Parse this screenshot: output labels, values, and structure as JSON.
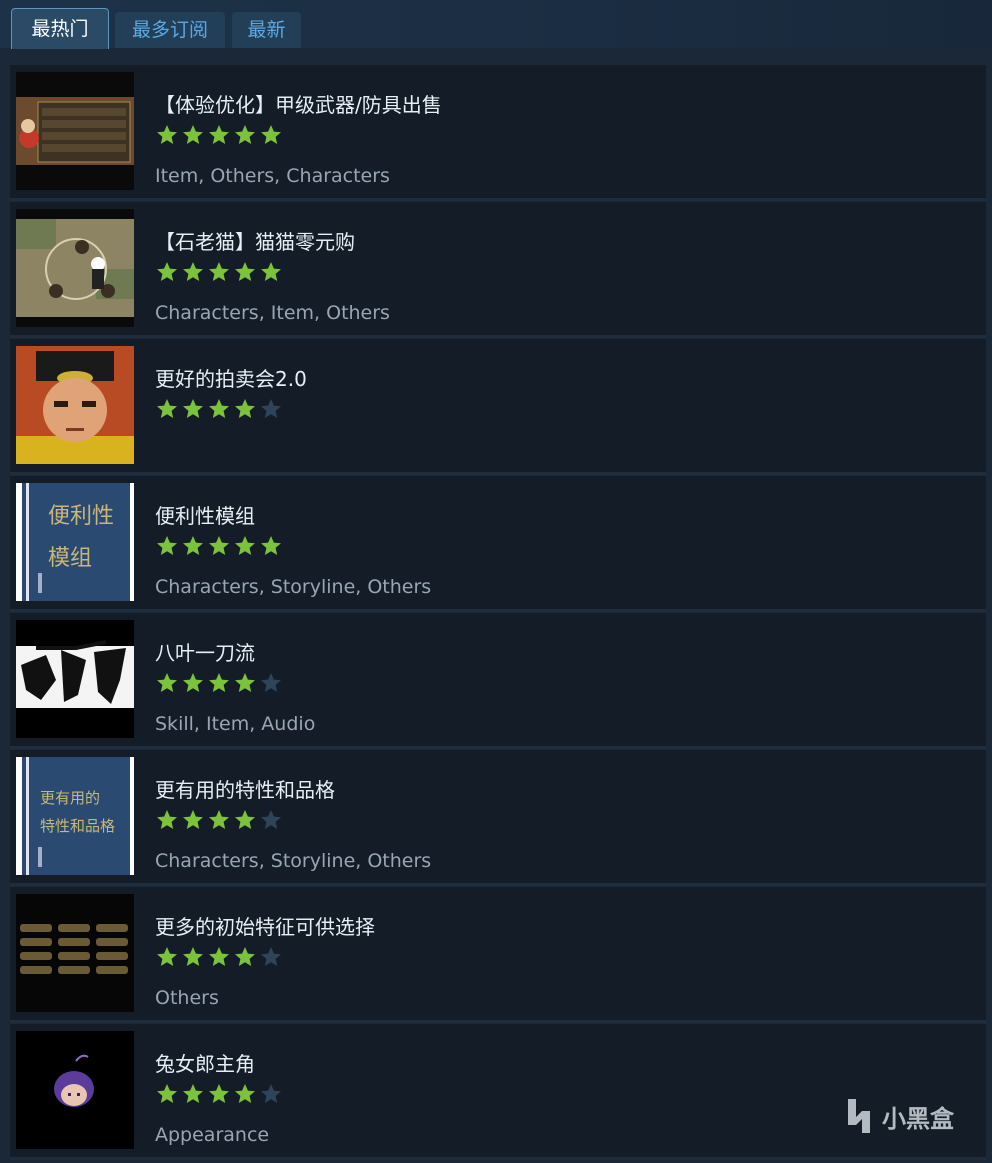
{
  "tabs": [
    {
      "label": "最热门",
      "active": true
    },
    {
      "label": "最多订阅",
      "active": false
    },
    {
      "label": "最新",
      "active": false
    }
  ],
  "items": [
    {
      "title": "【体验优化】甲级武器/防具出售",
      "rating": 5,
      "tags": "Item, Others, Characters"
    },
    {
      "title": "【石老猫】猫猫零元购",
      "rating": 5,
      "tags": "Characters, Item, Others"
    },
    {
      "title": "更好的拍卖会2.0",
      "rating": 4,
      "tags": ""
    },
    {
      "title": "便利性模组",
      "rating": 5,
      "tags": "Characters, Storyline, Others",
      "thumb_text": [
        "便利性",
        "模组"
      ]
    },
    {
      "title": "八叶一刀流",
      "rating": 4,
      "tags": "Skill, Item, Audio"
    },
    {
      "title": "更有用的特性和品格",
      "rating": 4,
      "tags": "Characters, Storyline, Others",
      "thumb_text": [
        "更有用的",
        "特性和品格"
      ]
    },
    {
      "title": "更多的初始特征可供选择",
      "rating": 4,
      "tags": "Others"
    },
    {
      "title": "兔女郎主角",
      "rating": 4,
      "tags": "Appearance"
    }
  ],
  "colors": {
    "star_on": "#7cc23a",
    "star_off": "#2f4458",
    "accent": "#5aa9e6"
  },
  "watermark": {
    "text": "小黑盒",
    "icon": "heybox-logo-icon"
  }
}
